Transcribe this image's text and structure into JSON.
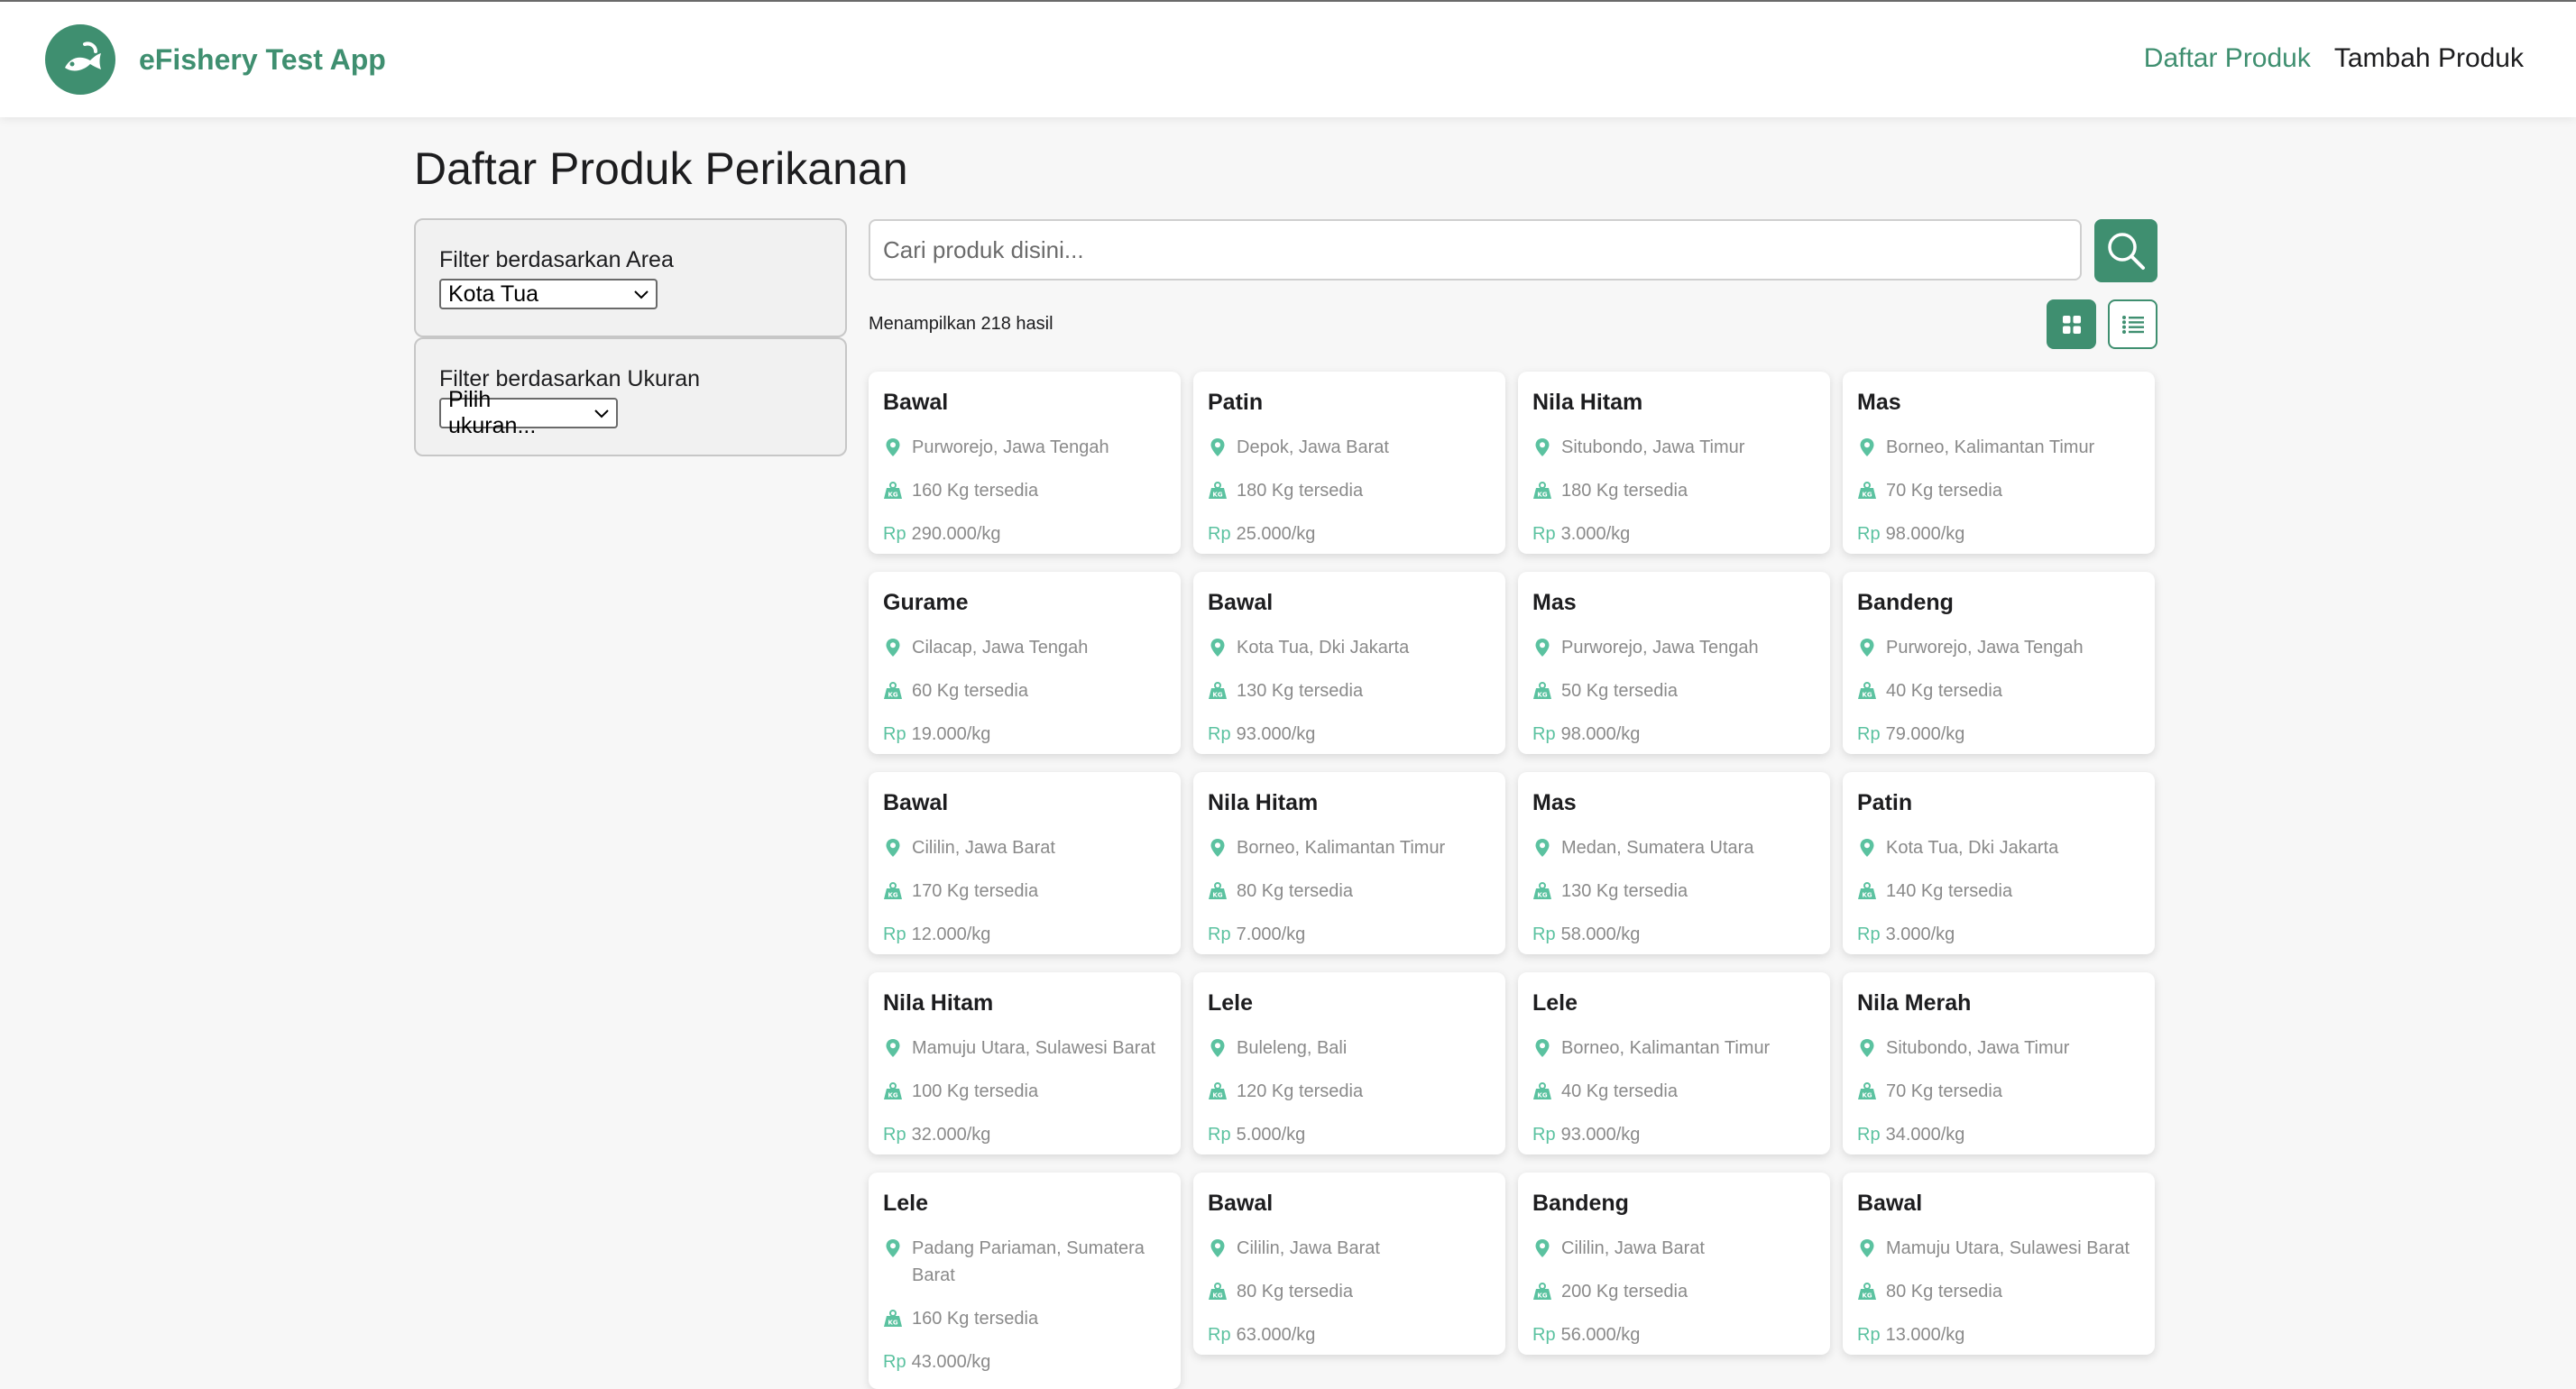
{
  "navbar": {
    "brand": "eFishery Test App",
    "links": [
      "Daftar Produk",
      "Tambah Produk"
    ]
  },
  "page": {
    "title": "Daftar Produk Perikanan"
  },
  "filters": {
    "area": {
      "label": "Filter berdasarkan Area",
      "selected": "Kota Tua"
    },
    "size": {
      "label": "Filter berdasarkan Ukuran",
      "selected": "Pilih ukuran..."
    }
  },
  "search": {
    "placeholder": "Cari produk disini..."
  },
  "results": {
    "count_text": "Menampilkan 218 hasil"
  },
  "currency": "Rp",
  "colors": {
    "brand": "#3f8f70",
    "accent": "#5bc2a0"
  },
  "products": [
    {
      "name": "Bawal",
      "location": "Purworejo, Jawa Tengah",
      "stock": "160 Kg tersedia",
      "price": "290.000/kg"
    },
    {
      "name": "Patin",
      "location": "Depok, Jawa Barat",
      "stock": "180 Kg tersedia",
      "price": "25.000/kg"
    },
    {
      "name": "Nila Hitam",
      "location": "Situbondo, Jawa Timur",
      "stock": "180 Kg tersedia",
      "price": "3.000/kg"
    },
    {
      "name": "Mas",
      "location": "Borneo, Kalimantan Timur",
      "stock": "70 Kg tersedia",
      "price": "98.000/kg"
    },
    {
      "name": "Gurame",
      "location": "Cilacap, Jawa Tengah",
      "stock": "60 Kg tersedia",
      "price": "19.000/kg"
    },
    {
      "name": "Bawal",
      "location": "Kota Tua, Dki Jakarta",
      "stock": "130 Kg tersedia",
      "price": "93.000/kg"
    },
    {
      "name": "Mas",
      "location": "Purworejo, Jawa Tengah",
      "stock": "50 Kg tersedia",
      "price": "98.000/kg"
    },
    {
      "name": "Bandeng",
      "location": "Purworejo, Jawa Tengah",
      "stock": "40 Kg tersedia",
      "price": "79.000/kg"
    },
    {
      "name": "Bawal",
      "location": "Cililin, Jawa Barat",
      "stock": "170 Kg tersedia",
      "price": "12.000/kg"
    },
    {
      "name": "Nila Hitam",
      "location": "Borneo, Kalimantan Timur",
      "stock": "80 Kg tersedia",
      "price": "7.000/kg"
    },
    {
      "name": "Mas",
      "location": "Medan, Sumatera Utara",
      "stock": "130 Kg tersedia",
      "price": "58.000/kg"
    },
    {
      "name": "Patin",
      "location": "Kota Tua, Dki Jakarta",
      "stock": "140 Kg tersedia",
      "price": "3.000/kg"
    },
    {
      "name": "Nila Hitam",
      "location": "Mamuju Utara, Sulawesi Barat",
      "stock": "100 Kg tersedia",
      "price": "32.000/kg"
    },
    {
      "name": "Lele",
      "location": "Buleleng, Bali",
      "stock": "120 Kg tersedia",
      "price": "5.000/kg"
    },
    {
      "name": "Lele",
      "location": "Borneo, Kalimantan Timur",
      "stock": "40 Kg tersedia",
      "price": "93.000/kg"
    },
    {
      "name": "Nila Merah",
      "location": "Situbondo, Jawa Timur",
      "stock": "70 Kg tersedia",
      "price": "34.000/kg"
    },
    {
      "name": "Lele",
      "location": "Padang Pariaman, Sumatera Barat",
      "stock": "160 Kg tersedia",
      "price": "43.000/kg"
    },
    {
      "name": "Bawal",
      "location": "Cililin, Jawa Barat",
      "stock": "80 Kg tersedia",
      "price": "63.000/kg"
    },
    {
      "name": "Bandeng",
      "location": "Cililin, Jawa Barat",
      "stock": "200 Kg tersedia",
      "price": "56.000/kg"
    },
    {
      "name": "Bawal",
      "location": "Mamuju Utara, Sulawesi Barat",
      "stock": "80 Kg tersedia",
      "price": "13.000/kg"
    }
  ]
}
